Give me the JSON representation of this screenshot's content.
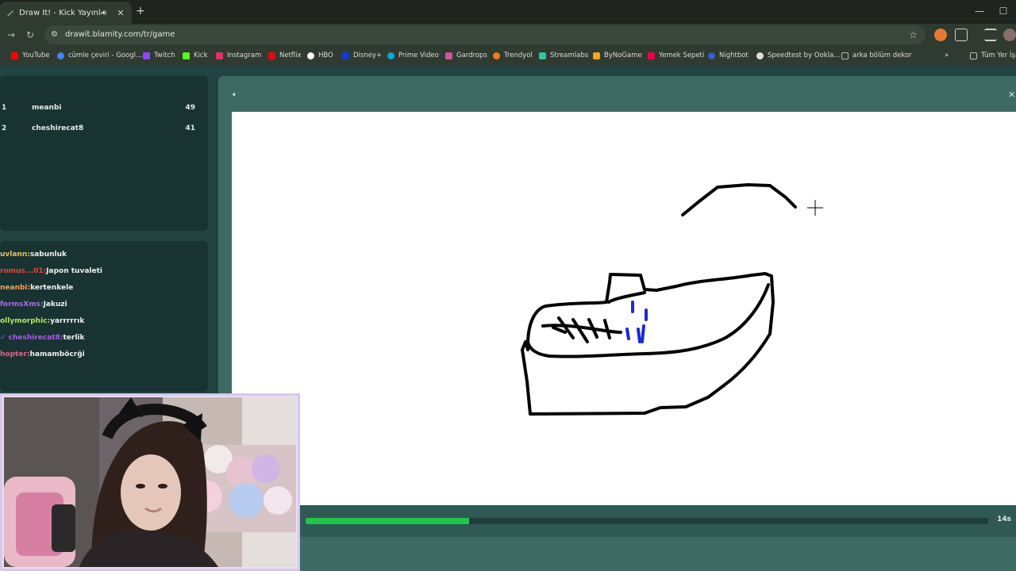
{
  "browser": {
    "tab_title": "Draw It! - Kick Yayınları İçin",
    "url": "drawit.blamity.com/tr/game",
    "bookmarks": [
      {
        "label": "YouTube",
        "color": "#ff0000"
      },
      {
        "label": "cümle çeviri - Googl...",
        "color": "#4285f4"
      },
      {
        "label": "Twitch",
        "color": "#9146ff"
      },
      {
        "label": "Kick",
        "color": "#53fc18"
      },
      {
        "label": "Instagram",
        "color": "#e1306c"
      },
      {
        "label": "Netflix",
        "color": "#e50914"
      },
      {
        "label": "HBO",
        "color": "#ffffff"
      },
      {
        "label": "Disney+",
        "color": "#113ccf"
      },
      {
        "label": "Prime Video",
        "color": "#00a8e1"
      },
      {
        "label": "Gardrops",
        "color": "#d0559b"
      },
      {
        "label": "Trendyol",
        "color": "#f27a1a"
      },
      {
        "label": "Streamlabs",
        "color": "#31c3a2"
      },
      {
        "label": "ByNoGame",
        "color": "#f6a31a"
      },
      {
        "label": "Yemek Sepeti",
        "color": "#ea004b"
      },
      {
        "label": "Nightbot",
        "color": "#3a5bcc"
      },
      {
        "label": "Speedtest by Ookla...",
        "color": "#dddddd"
      },
      {
        "label": "arka bölüm dekor",
        "color": "#bbbbbb"
      }
    ],
    "all_bookmarks": "Tüm Yer İşa"
  },
  "leaderboard": [
    {
      "rank": "1",
      "name": "meanbi",
      "score": "49"
    },
    {
      "rank": "2",
      "name": "cheshirecat8",
      "score": "41"
    }
  ],
  "chat": [
    {
      "user": "uvlann",
      "text": "sabunluk",
      "color": "#e9c35a"
    },
    {
      "user": "romus...01",
      "text": "Japon tuvaleti",
      "color": "#e8453c"
    },
    {
      "user": "neanbi",
      "text": "kertenkele",
      "color": "#f0a25a"
    },
    {
      "user": "formsXms",
      "text": "Jakuzi",
      "color": "#a86ee8"
    },
    {
      "user": "ollymorphic",
      "text": "yarrrrrık",
      "color": "#b6e85a"
    },
    {
      "user": "✓ cheshirecat8",
      "text": "terlik",
      "color": "#b455f0"
    },
    {
      "user": "hopter",
      "text": "hamamböcrği",
      "color": "#f05a8c"
    }
  ],
  "game": {
    "timer": "14s",
    "progress_percent": 24,
    "accent": "#21c44a"
  }
}
